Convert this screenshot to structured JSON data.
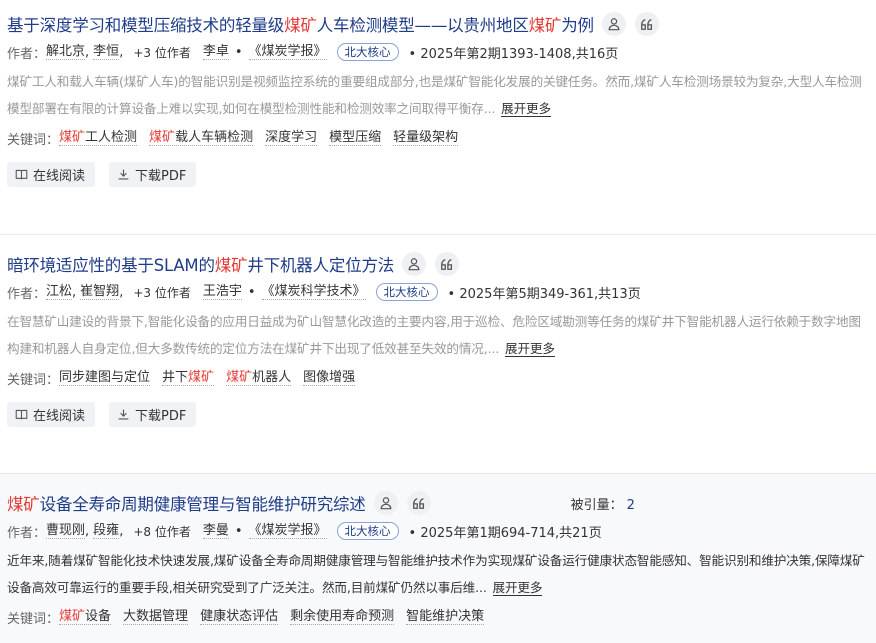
{
  "labels": {
    "authors": "作者：",
    "keywords": "关键词：",
    "expand": "展开更多",
    "read_online": "在线阅读",
    "download_pdf": "下载PDF",
    "cited": "被引量："
  },
  "articles": [
    {
      "title_parts": [
        {
          "text": "基于深度学习和模型压缩技术的轻量级",
          "hl": false
        },
        {
          "text": "煤矿",
          "hl": true
        },
        {
          "text": "人车检测模型——以贵州地区",
          "hl": false
        },
        {
          "text": "煤矿",
          "hl": true
        },
        {
          "text": "为例",
          "hl": false
        }
      ],
      "authors": [
        "解北京",
        "李恒"
      ],
      "more_authors": "+3 位作者",
      "editor": "李卓",
      "journal": "《煤炭学报》",
      "badge": "北大核心",
      "issue": "2025年第2期1393-1408,共16页",
      "abstract": "煤矿工人和载人车辆(煤矿人车)的智能识别是视频监控系统的重要组成部分,也是煤矿智能化发展的关键任务。然而,煤矿人车检测场景较为复杂,大型人车检测模型部署在有限的计算设备上难以实现,如何在模型检测性能和检测效率之间取得平衡存...",
      "keywords": [
        [
          {
            "text": "煤矿",
            "hl": true
          },
          {
            "text": "工人检测",
            "hl": false
          }
        ],
        [
          {
            "text": "煤矿",
            "hl": true
          },
          {
            "text": "载人车辆检测",
            "hl": false
          }
        ],
        [
          {
            "text": "深度学习",
            "hl": false
          }
        ],
        [
          {
            "text": "模型压缩",
            "hl": false
          }
        ],
        [
          {
            "text": "轻量级架构",
            "hl": false
          }
        ]
      ]
    },
    {
      "title_parts": [
        {
          "text": "暗环境适应性的基于SLAM的",
          "hl": false
        },
        {
          "text": "煤矿",
          "hl": true
        },
        {
          "text": "井下机器人定位方法",
          "hl": false
        }
      ],
      "authors": [
        "江松",
        "崔智翔"
      ],
      "more_authors": "+3 位作者",
      "editor": "王浩宇",
      "journal": "《煤炭科学技术》",
      "badge": "北大核心",
      "issue": "2025年第5期349-361,共13页",
      "abstract": "在智慧矿山建设的背景下,智能化设备的应用日益成为矿山智慧化改造的主要内容,用于巡检、危险区域勘测等任务的煤矿井下智能机器人运行依赖于数字地图构建和机器人自身定位,但大多数传统的定位方法在煤矿井下出现了低效甚至失效的情况,...",
      "keywords": [
        [
          {
            "text": "同步建图与定位",
            "hl": false
          }
        ],
        [
          {
            "text": "井下",
            "hl": false
          },
          {
            "text": "煤矿",
            "hl": true
          }
        ],
        [
          {
            "text": "煤矿",
            "hl": true
          },
          {
            "text": "机器人",
            "hl": false
          }
        ],
        [
          {
            "text": "图像增强",
            "hl": false
          }
        ]
      ]
    },
    {
      "title_parts": [
        {
          "text": "煤矿",
          "hl": true
        },
        {
          "text": "设备全寿命周期健康管理与智能维护研究综述",
          "hl": false
        }
      ],
      "cited": "2",
      "authors": [
        "曹现刚",
        "段雍"
      ],
      "more_authors": "+8 位作者",
      "editor": "李曼",
      "journal": "《煤炭学报》",
      "badge": "北大核心",
      "issue": "2025年第1期694-714,共21页",
      "abstract": "近年来,随着煤矿智能化技术快速发展,煤矿设备全寿命周期健康管理与智能维护技术作为实现煤矿设备运行健康状态智能感知、智能识别和维护决策,保障煤矿设备高效可靠运行的重要手段,相关研究受到了广泛关注。然而,目前煤矿仍然以事后维...",
      "keywords": [
        [
          {
            "text": "煤矿",
            "hl": true
          },
          {
            "text": "设备",
            "hl": false
          }
        ],
        [
          {
            "text": "大数据管理",
            "hl": false
          }
        ],
        [
          {
            "text": "健康状态评估",
            "hl": false
          }
        ],
        [
          {
            "text": "剩余使用寿命预测",
            "hl": false
          }
        ],
        [
          {
            "text": "智能维护决策",
            "hl": false
          }
        ]
      ]
    }
  ]
}
